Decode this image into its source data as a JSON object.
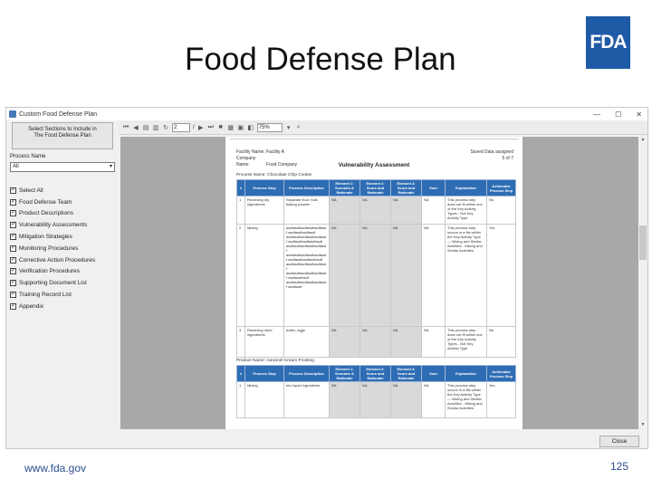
{
  "slide": {
    "title": "Food Defense Plan",
    "logo": "FDA",
    "footer_url": "www.fda.gov",
    "page_number": "125"
  },
  "window": {
    "title": "Custom Food Defense Plan",
    "controls": [
      "—",
      "☐",
      "✕"
    ]
  },
  "sidebar": {
    "select_button": [
      "Select Sections to Include in",
      "The Food Defense Plan"
    ],
    "process_label": "Process Name",
    "process_value": "All",
    "items": [
      {
        "label": "Select All",
        "checked": true
      },
      {
        "label": "Food Defense Team",
        "checked": true
      },
      {
        "label": "Product Descriptions",
        "checked": true
      },
      {
        "label": "Vulnerability Assessments",
        "checked": true
      },
      {
        "label": "Mitigation Strategies",
        "checked": true
      },
      {
        "label": "Monitoring Procedures",
        "checked": true
      },
      {
        "label": "Corrective Action Procedures",
        "checked": true
      },
      {
        "label": "Verification Procedures",
        "checked": true
      },
      {
        "label": "Supporting Document List",
        "checked": true
      },
      {
        "label": "Training Record List",
        "checked": true
      },
      {
        "label": "Appendix",
        "checked": true
      }
    ]
  },
  "toolbar": {
    "page_value": "2",
    "page_total": "/ ",
    "zoom_value": "75%"
  },
  "document": {
    "facility_label": "Facility Name:",
    "facility_value": "Facility A",
    "company_label": "Company Name:",
    "company_value": "Food Company",
    "page_right_line1": "Saved Data assigned",
    "page_right_line2": "5 of 7",
    "title": "Vulnerability Assessment",
    "section1": "Process Name: Chocolate Chip Cookie",
    "section2": "Product Name: Caramel Cream Frosting",
    "columns": [
      "#",
      "Process Step",
      "Process Description",
      "Element 1: Scenario & Rationale",
      "Element 2: Score and Rationale",
      "Element 3: Score and Rationale",
      "Sum",
      "Explanation",
      "Actionable Process Step"
    ],
    "rows1": [
      {
        "num": "1",
        "step": "Receiving dry ingredients",
        "desc": "Separate flour; bulk baking powder",
        "e1": "NA",
        "e2": "NA",
        "e3": "NA",
        "sum": "NA",
        "expl": "This process step does not fit within one of the Key Activity Types - Not Key Activity Type",
        "act": "No"
      },
      {
        "num": "2",
        "step": "Mixing",
        "desc": "asdfasdfasdfasdfasdfasdf asdfasdfasdfasdf asdfasdfasdfasdfasdfasdf asdfasdfasdfasdfasdf asdfasdfasdfasdfasdfasdf asdfasdfasdfasdfasdfasdf asdfasdfasdfasdfasdf asdfasdfasdfasdfasdfasdf asdfasdfasdfasdfasdfasdf asdfasdfasdf asdfasdfasdfasdfasdfasdf asdfasdf",
        "e1": "NA",
        "e2": "NA",
        "e3": "NA",
        "sum": "NA",
        "expl": "This process step occurs in a fits within the Key Activity Type — Mixing and Similar Activities - Mixing and Similar Activities",
        "act": "Yes"
      },
      {
        "num": "3",
        "step": "Receiving other ingredients",
        "desc": "butter, eggs",
        "e1": "NA",
        "e2": "NA",
        "e3": "NA",
        "sum": "NA",
        "expl": "This process step does not fit within one of the Key Activity Types - Not Key Activity Type",
        "act": "No"
      }
    ],
    "rows2": [
      {
        "num": "1",
        "step": "Mixing",
        "desc": "mix liquid ingredients",
        "e1": "NA",
        "e2": "NA",
        "e3": "NA",
        "sum": "NA",
        "expl": "This process step occurs in a fits within the Key Activity Type — Mixing and Similar Activities - Mixing and Similar Activities",
        "act": "Yes"
      }
    ]
  },
  "buttons": {
    "close": "Close"
  },
  "colors": {
    "fda_blue": "#1f5aa6",
    "table_header": "#2e6db4",
    "viewer_bg": "#a8a8a8"
  }
}
